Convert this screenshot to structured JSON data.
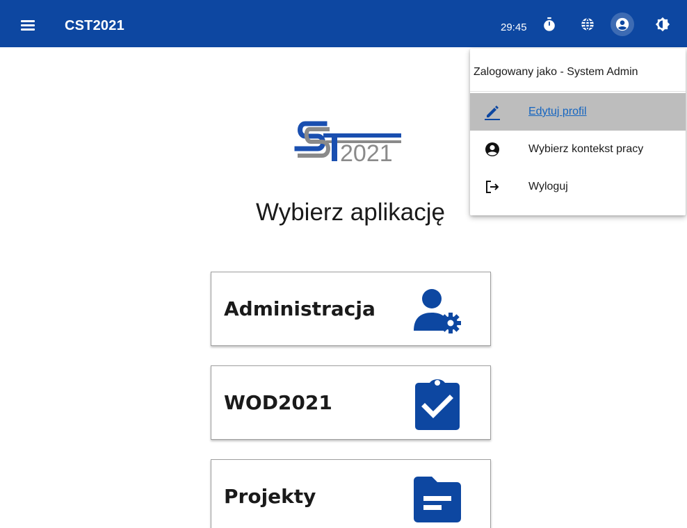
{
  "header": {
    "title": "CST2021",
    "timer": "29:45",
    "icons": [
      "menu-icon",
      "timer-icon",
      "globe-icon",
      "account-circle-icon",
      "brightness-icon"
    ],
    "bar_color": "#0d47a1"
  },
  "logo": {
    "letters": "ST",
    "year": "2021"
  },
  "main": {
    "title": "Wybierz aplikację",
    "cards": [
      {
        "label": "Administracja",
        "icon": "user-gear-icon"
      },
      {
        "label": "WOD2021",
        "icon": "clipboard-check-icon"
      },
      {
        "label": "Projekty",
        "icon": "folder-icon"
      }
    ],
    "accent_color": "#0d47a1"
  },
  "user_menu": {
    "header": "Zalogowany jako - System Admin",
    "items": [
      {
        "label": "Edytuj profil",
        "icon": "pencil-icon",
        "active": true
      },
      {
        "label": "Wybierz kontekst pracy",
        "icon": "account-circle-icon",
        "active": false
      },
      {
        "label": "Wyloguj",
        "icon": "logout-icon",
        "active": false
      }
    ],
    "active_bg": "#bdbdbd",
    "active_link_color": "#1565c0"
  }
}
